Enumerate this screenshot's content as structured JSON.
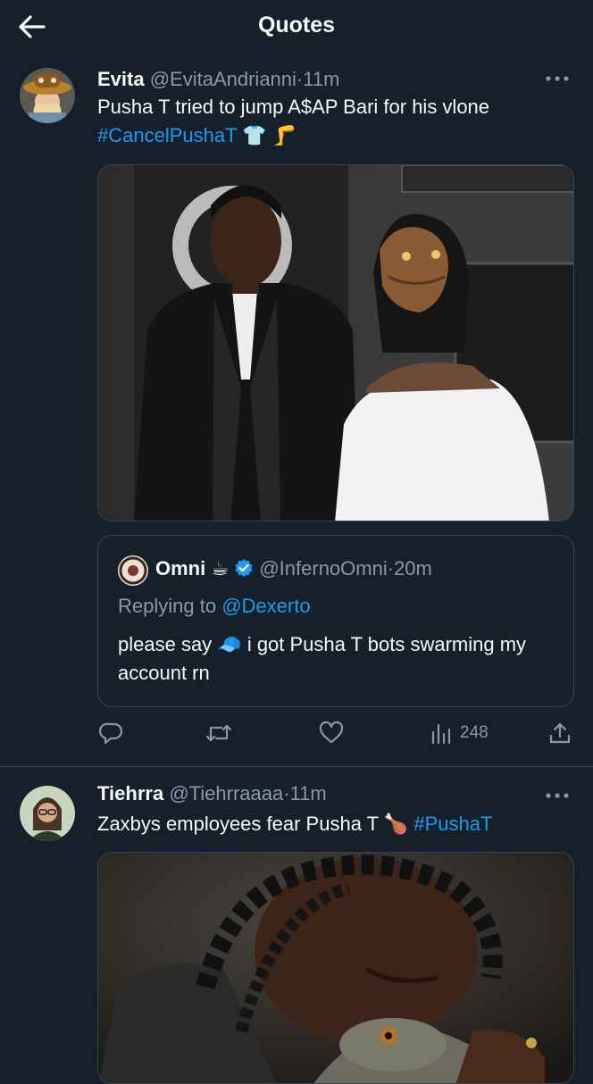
{
  "header": {
    "title": "Quotes"
  },
  "tweet1": {
    "name": "Evita",
    "handle": "@EvitaAndrianni",
    "dot": "·",
    "time": "11m",
    "text": "Pusha T tried to jump A$AP Bari for his vlone",
    "hashtag": "#CancelPushaT",
    "emoji": "👕 🦵",
    "quote": {
      "name": "Omni",
      "emoji": "☕",
      "handle": "@InfernoOmni",
      "dot": "·",
      "time": "20m",
      "replying_prefix": "Replying to ",
      "replying_to": "@Dexerto",
      "text_before": "please say ",
      "text_emoji": "🧢",
      "text_after": " i got Pusha T bots swarming my account rn"
    },
    "actions": {
      "views": "248"
    }
  },
  "tweet2": {
    "name": "Tiehrra",
    "handle": "@Tiehrraaaa",
    "dot": "·",
    "time": "11m",
    "text": "Zaxbys employees fear Pusha T ",
    "emoji": "🍗",
    "hashtag": "#PushaT"
  },
  "colors": {
    "background": "#15202b",
    "accent": "#1d9bf0",
    "secondary": "#8b98a5",
    "border": "#38444d"
  },
  "icons": [
    "back-arrow-icon",
    "more-icon",
    "verified-badge-icon",
    "reply-icon",
    "retweet-icon",
    "like-icon",
    "views-icon",
    "share-icon"
  ]
}
